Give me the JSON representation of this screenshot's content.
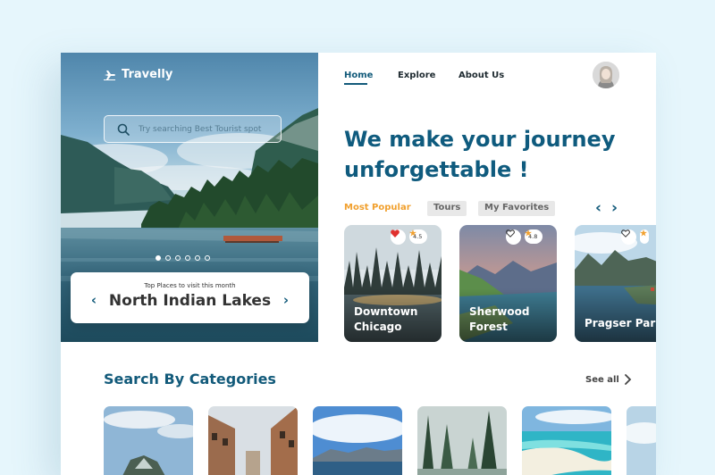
{
  "brand": {
    "name": "Travelly",
    "logo_icon": "plane-icon"
  },
  "search": {
    "placeholder": "Try searching Best Tourist spot"
  },
  "carousel": {
    "slides": 6,
    "active_slide": 1
  },
  "featured_place": {
    "subtitle": "Top Places to visit this month",
    "title": "North Indian Lakes",
    "prev_arrow": "‹",
    "next_arrow": "›"
  },
  "nav": {
    "links": [
      "Home",
      "Explore",
      "About Us"
    ],
    "active": "Home"
  },
  "headline": {
    "line1": "We make your journey",
    "line2": "unforgettable !"
  },
  "filters": {
    "items": [
      "Most Popular",
      "Tours",
      "My Favorites"
    ],
    "active": "Most Popular"
  },
  "destinations": [
    {
      "name_line1": "Downtown",
      "name_line2": "Chicago",
      "rating": "4.5",
      "favorited": true
    },
    {
      "name_line1": "Sherwood",
      "name_line2": "Forest",
      "rating": "4.8",
      "favorited": false
    },
    {
      "name_line1": "Pragser Park",
      "name_line2": "",
      "rating": "",
      "favorited": false
    }
  ],
  "categories_section": {
    "title": "Search By Categories",
    "see_all_label": "See all"
  },
  "colors": {
    "primary": "#125a7a",
    "accent": "#f1a02e",
    "heart": "#e0312e",
    "star": "#f1a02e",
    "background": "#e6f6fc"
  }
}
